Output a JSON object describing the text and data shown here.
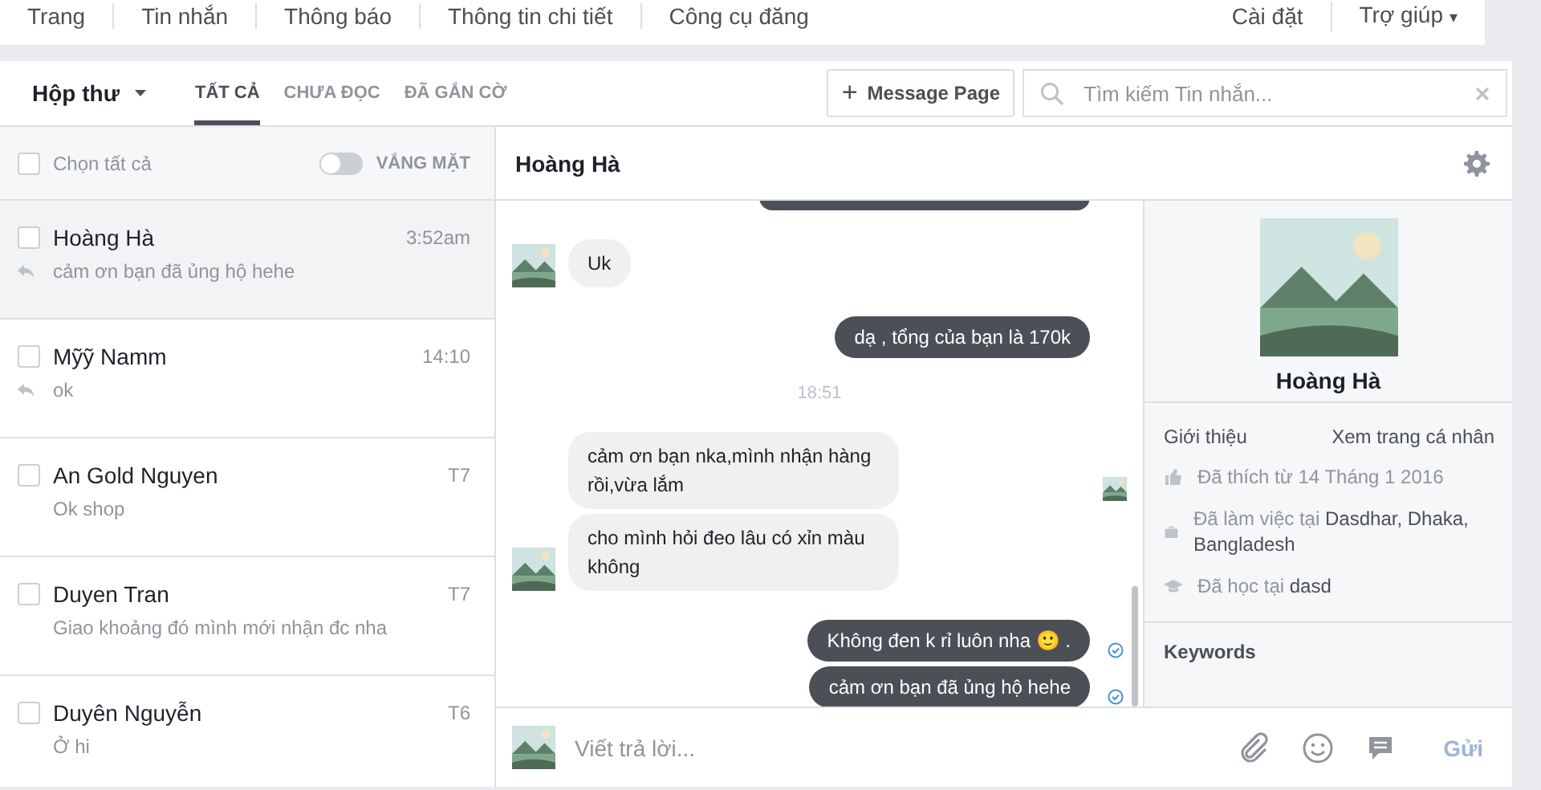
{
  "top_nav": {
    "left": [
      {
        "label": "Trang",
        "selected": false
      },
      {
        "label": "Tin nhắn",
        "selected": false
      },
      {
        "label": "Thông báo",
        "selected": false
      },
      {
        "label": "Thông tin chi tiết",
        "selected": false
      },
      {
        "label": "Công cụ đăng",
        "selected": false
      }
    ],
    "right": [
      {
        "label": "Cài đặt"
      },
      {
        "label": "Trợ giúp",
        "caret": "▾"
      }
    ]
  },
  "inbox": {
    "label": "Hộp thư",
    "tabs": [
      {
        "label": "TẤT CẢ",
        "selected": true
      },
      {
        "label": "CHƯA ĐỌC",
        "selected": false
      },
      {
        "label": "ĐÃ GẮN CỜ",
        "selected": false
      }
    ]
  },
  "message_page_button": {
    "icon": "+",
    "label": "Message Page"
  },
  "search": {
    "placeholder": "Tìm kiếm Tin nhắn..."
  },
  "select_all": {
    "label": "Chọn tất cả",
    "checked": false
  },
  "away_toggle": {
    "label": "VẮNG MẶT",
    "on": false
  },
  "conversations": [
    {
      "name": "Hoàng Hà",
      "time": "3:52am",
      "preview": "cảm ơn bạn đã ủng hộ hehe",
      "replied": true,
      "checked": false,
      "selected": true
    },
    {
      "name": "Mỹỹ Namm",
      "time": "14:10",
      "preview": "ok",
      "replied": true,
      "checked": false,
      "selected": false
    },
    {
      "name": "An Gold Nguyen",
      "time": "T7",
      "preview": "Ok shop",
      "replied": false,
      "checked": false,
      "selected": false
    },
    {
      "name": "Duyen Tran",
      "time": "T7",
      "preview": "Giao khoảng đó mình mới nhận đc nha",
      "replied": false,
      "checked": false,
      "selected": false
    },
    {
      "name": "Duyên Nguyễn",
      "time": "T6",
      "preview": "Ở hi",
      "replied": false,
      "checked": false,
      "selected": false
    }
  ],
  "chat": {
    "title": "Hoàng Hà",
    "messages": [
      {
        "kind": "clipped"
      },
      {
        "kind": "received",
        "text": "Uk",
        "avatar": true
      },
      {
        "kind": "sent",
        "text": "dạ , tổng của bạn là 170k",
        "delivered": false
      },
      {
        "kind": "time",
        "text": "18:51"
      },
      {
        "kind": "received",
        "text": "cảm ơn bạn nka,mình nhận hàng rồi,vừa lắm",
        "avatar": false,
        "seen_marker": true
      },
      {
        "kind": "received",
        "text": "cho mình hỏi đeo lâu có xỉn màu không",
        "avatar": true
      },
      {
        "kind": "sent",
        "text": "Không đen k rỉ luôn nha 🙂 .",
        "delivered": true
      },
      {
        "kind": "sent",
        "text": "cảm ơn bạn đã ủng hộ hehe",
        "delivered": true
      }
    ],
    "composer": {
      "placeholder": "Viết trả lời...",
      "send_label": "Gửi"
    }
  },
  "profile": {
    "name": "Hoàng Hà",
    "about_label": "Giới thiệu",
    "profile_link": "Xem trang cá nhân",
    "facts": [
      {
        "kind": "like",
        "text": "Đã thích từ 14 Tháng 1 2016"
      },
      {
        "kind": "work",
        "text": "Đã làm việc tại",
        "value": "Dasdhar, Dhaka, Bangladesh"
      },
      {
        "kind": "study",
        "text": "Đã học tại",
        "value": "dasd"
      }
    ],
    "keywords_label": "Keywords"
  }
}
